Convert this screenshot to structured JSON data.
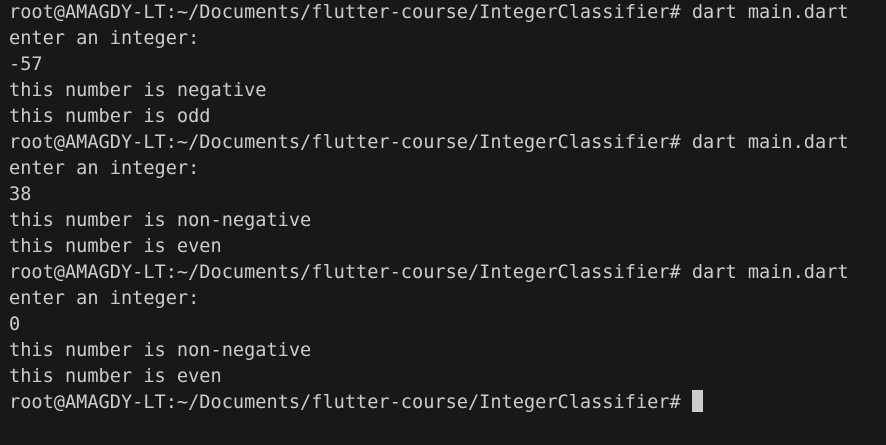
{
  "terminal": {
    "lines": [
      "root@AMAGDY-LT:~/Documents/flutter-course/IntegerClassifier# dart main.dart",
      "enter an integer:",
      "-57",
      "this number is negative",
      "this number is odd",
      "root@AMAGDY-LT:~/Documents/flutter-course/IntegerClassifier# dart main.dart",
      "enter an integer:",
      "38",
      "this number is non-negative",
      "this number is even",
      "root@AMAGDY-LT:~/Documents/flutter-course/IntegerClassifier# dart main.dart",
      "enter an integer:",
      "0",
      "this number is non-negative",
      "this number is even"
    ],
    "prompt": "root@AMAGDY-LT:~/Documents/flutter-course/IntegerClassifier#"
  },
  "colors": {
    "background": "#181818",
    "foreground": "#cccccc",
    "cursor": "#cccccc"
  }
}
